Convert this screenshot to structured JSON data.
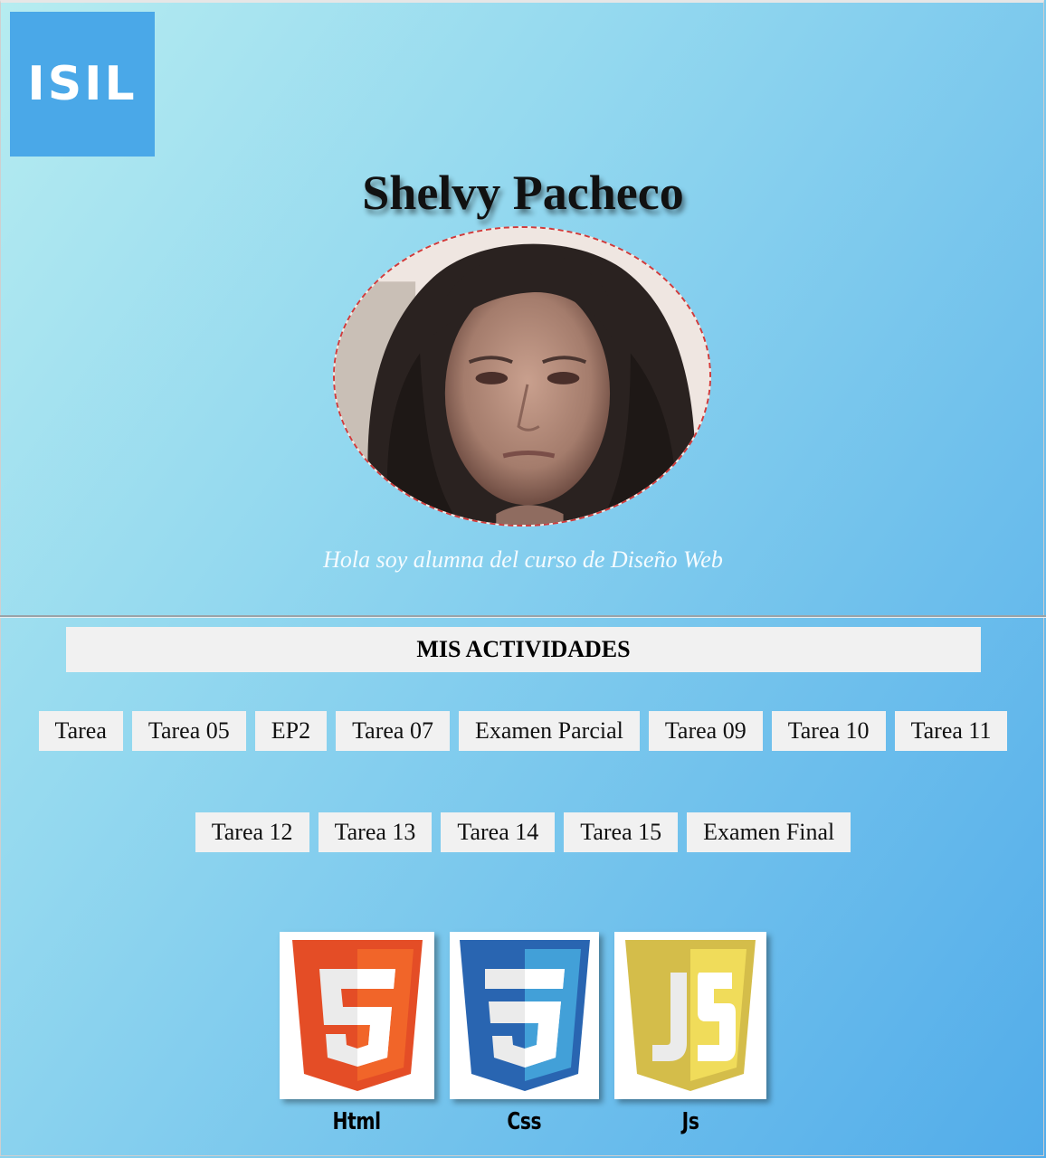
{
  "logo": {
    "text": "ISIL"
  },
  "profile": {
    "name": "Shelvy Pacheco",
    "intro": "Hola soy alumna del curso de Diseño Web"
  },
  "activities": {
    "title": "MIS ACTIVIDADES",
    "row1": [
      "Tarea",
      "Tarea 05",
      "EP2",
      "Tarea 07",
      "Examen Parcial",
      "Tarea 09",
      "Tarea 10",
      "Tarea 11"
    ],
    "row2": [
      "Tarea 12",
      "Tarea 13",
      "Tarea 14",
      "Tarea 15",
      "Examen Final"
    ]
  },
  "technologies": [
    {
      "label": "Html",
      "icon": "html5-icon",
      "color": "#e44d26"
    },
    {
      "label": "Css",
      "icon": "css3-icon",
      "color": "#2965b1"
    },
    {
      "label": "Js",
      "icon": "js-icon",
      "color": "#d4bd4a"
    }
  ]
}
